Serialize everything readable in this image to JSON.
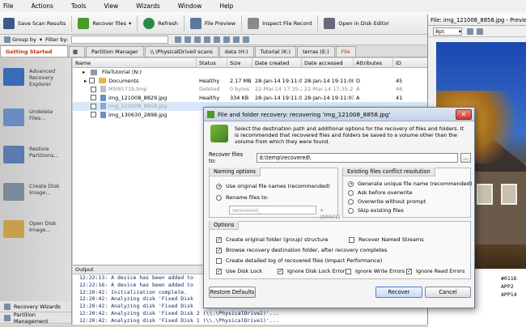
{
  "menu": [
    "File",
    "Actions",
    "Tools",
    "View",
    "Wizards",
    "Window",
    "Help"
  ],
  "toolbar": {
    "save_scan": "Save Scan Results",
    "recover_files": "Recover files",
    "refresh": "Refresh",
    "file_preview": "File Preview",
    "inspect": "Inspect File Record",
    "open_disk_editor": "Open in Disk Editor"
  },
  "toolbar2": {
    "group_by": "Group by",
    "filter_by": "Filter by:"
  },
  "tabs": [
    "Getting Started",
    "Partition Manager",
    "\\\\.\\PhysicalDrive0 scans",
    "data (H:)",
    "Tutorial (K:)",
    "terras (E:)",
    "File"
  ],
  "left_panel": [
    {
      "label": "Advanced Recovery Explorer",
      "color": "#3a6ab8"
    },
    {
      "label": "Undelete Files...",
      "color": "#6a8cc0"
    },
    {
      "label": "Restore Partitions...",
      "color": "#5a7ab0"
    },
    {
      "label": "Create Disk Image...",
      "color": "#7a8a9a"
    },
    {
      "label": "Open Disk Image...",
      "color": "#c8a04a"
    }
  ],
  "nav_bottom": [
    "Recovery Wizards",
    "Partition Management"
  ],
  "file_list": {
    "columns": [
      "Name",
      "Status",
      "Size",
      "Date created",
      "Date accessed",
      "Attributes",
      "ID"
    ],
    "root": "FileTutorial (N:)",
    "rows": [
      {
        "name": "Documents",
        "status": "Healthy",
        "size": "2.17 MB",
        "created": "28-Jan-14 19:11:00",
        "accessed": "28-Jan-14 19:11:00",
        "attr": "D",
        "id": "45"
      },
      {
        "name": "MSI8171b.tmp",
        "status": "Deleted",
        "size": "0 bytes",
        "created": "22-Mar-14 17:35:22",
        "accessed": "22-Mar-14 17:35:22",
        "attr": "A",
        "id": "46"
      },
      {
        "name": "img_121008_8829.jpg",
        "status": "Healthy",
        "size": "334 KB",
        "created": "28-Jan-14 19:11:03",
        "accessed": "28-Jan-14 19:11:03",
        "attr": "A",
        "id": "41"
      },
      {
        "name": "img_121008_8858.jpg",
        "status": "",
        "size": "",
        "created": "",
        "accessed": "",
        "attr": "",
        "id": ""
      },
      {
        "name": "img_130630_2898.jpg",
        "status": "",
        "size": "",
        "created": "",
        "accessed": "",
        "attr": "",
        "id": ""
      }
    ]
  },
  "output": {
    "title": "Output",
    "lines": [
      "12:22:13: A device has been added to",
      "12:22:16: A device has been added to",
      "12:20:42: Initialization complete.",
      "12:20:42: Analyzing disk 'Fixed Disk",
      "12:20:42: Analyzing disk 'Fixed Disk",
      "12:20:42: Analyzing disk 'Fixed Disk 2 (\\\\.\\PhysicalDrive2)'...",
      "12:20:42: Analyzing disk 'Fixed Disk 1 (\\\\.\\PhysicalDrive1)'..."
    ]
  },
  "preview": {
    "title": "File: img_121008_8858.jpg - Preview",
    "zoom": "8pt",
    "hex_rows": [
      "#0116",
      "APP2",
      "APP14"
    ]
  },
  "dialog": {
    "title": "File and folder recovery: recovering 'img_121008_8858.jpg'",
    "description": "Select the destination path and additional options for the recovery of files and folders.  It is recommended that recovered files and folders be saved to a volume other than the volume from which they were found.",
    "recover_to_label": "Recover files to:",
    "recover_to_value": "d:\\temp\\recovered\\",
    "browse": "...",
    "naming": {
      "title": "Naming options",
      "use_original": "Use original file names (recommended)",
      "rename": "Rename files to:",
      "rename_placeholder": "recovered_",
      "suffix": "+ (00001)"
    },
    "conflict": {
      "title": "Existing files conflict resolution",
      "opts": [
        "Generate unique file name (recommended)",
        "Ask before overwrite",
        "Overwrite without prompt",
        "Skip existing files"
      ]
    },
    "options": {
      "title": "Options",
      "create_structure": "Create original folder (group) structure",
      "recover_streams": "Recover Named Streams",
      "browse_dest": "Browse recovery destination folder, after recovery completes",
      "create_log": "Create detailed log of recovered files (Impact Performance)",
      "use_disk_lock": "Use Disk Lock",
      "ignore_lock": "Ignore Disk Lock Errors",
      "ignore_write": "Ignore Write Errors",
      "ignore_read": "Ignore Read Errors"
    },
    "restore_defaults": "Restore Defaults",
    "recover": "Recover",
    "cancel": "Cancel"
  }
}
